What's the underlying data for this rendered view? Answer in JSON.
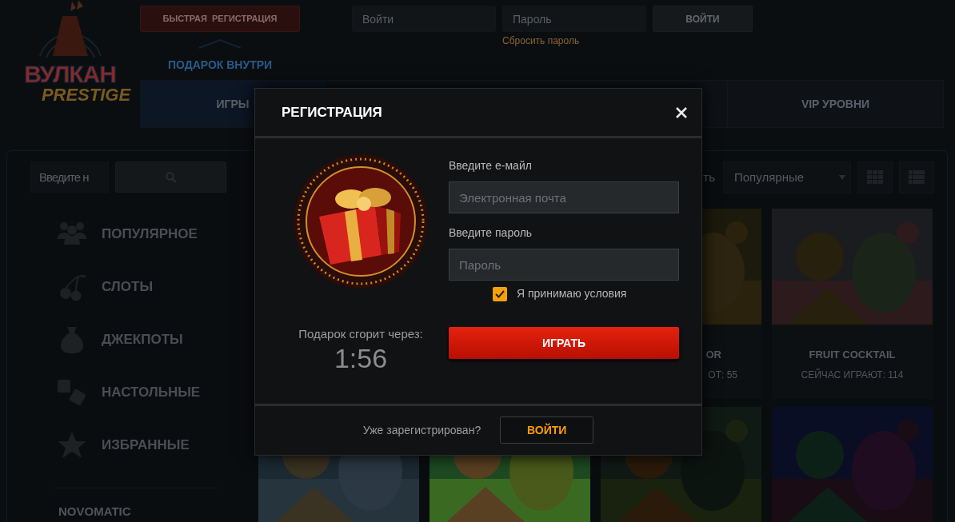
{
  "header": {
    "logo": {
      "title": "ВУЛКАН",
      "subtitle": "PRESTIGE"
    },
    "register_button": "БЫСТРАЯ  РЕГИСТРАЦИЯ",
    "gift_hint": "ПОДАРОК ВНУТРИ",
    "login": {
      "placeholder": "Войти"
    },
    "password": {
      "placeholder": "Пароль"
    },
    "login_button": "ВОЙТИ",
    "reset_link": "Сбросить пароль"
  },
  "nav_tabs": [
    {
      "label": "ИГРЫ",
      "selected": true
    },
    {
      "label": "VIP УРОВНИ",
      "selected": false
    }
  ],
  "sidebar": {
    "search": {
      "placeholder": "Введите н"
    },
    "items": [
      {
        "label": "ПОПУЛЯРНОЕ"
      },
      {
        "label": "СЛОТЫ"
      },
      {
        "label": "ДЖЕКПОТЫ"
      },
      {
        "label": "НАСТОЛЬНЫЕ"
      },
      {
        "label": "ИЗБРАННЫЕ"
      }
    ],
    "section_title": "NOVOMATIC"
  },
  "toolbar": {
    "sort_label": "ть",
    "sort_select": "Популярные"
  },
  "games_row_1": [
    {
      "title": "OR",
      "players": "ОТ: 55"
    },
    {
      "title": "FRUIT COCKTAIL",
      "players": "СЕЙЧАС ИГРАЮТ: 114"
    }
  ],
  "modal": {
    "title": "РЕГИСТРАЦИЯ",
    "gift_label": "Подарок сгорит через:",
    "timer": "1:56",
    "email": {
      "label": "Введите е-майл",
      "placeholder": "Электронная почта"
    },
    "password": {
      "label": "Введите пароль",
      "placeholder": "Пароль"
    },
    "terms": {
      "label": "Я принимаю условия",
      "checked": true
    },
    "play_button": "ИГРАТЬ",
    "footer": {
      "prompt": "Уже зарегистрирован?",
      "login_button": "ВОЙТИ"
    }
  }
}
